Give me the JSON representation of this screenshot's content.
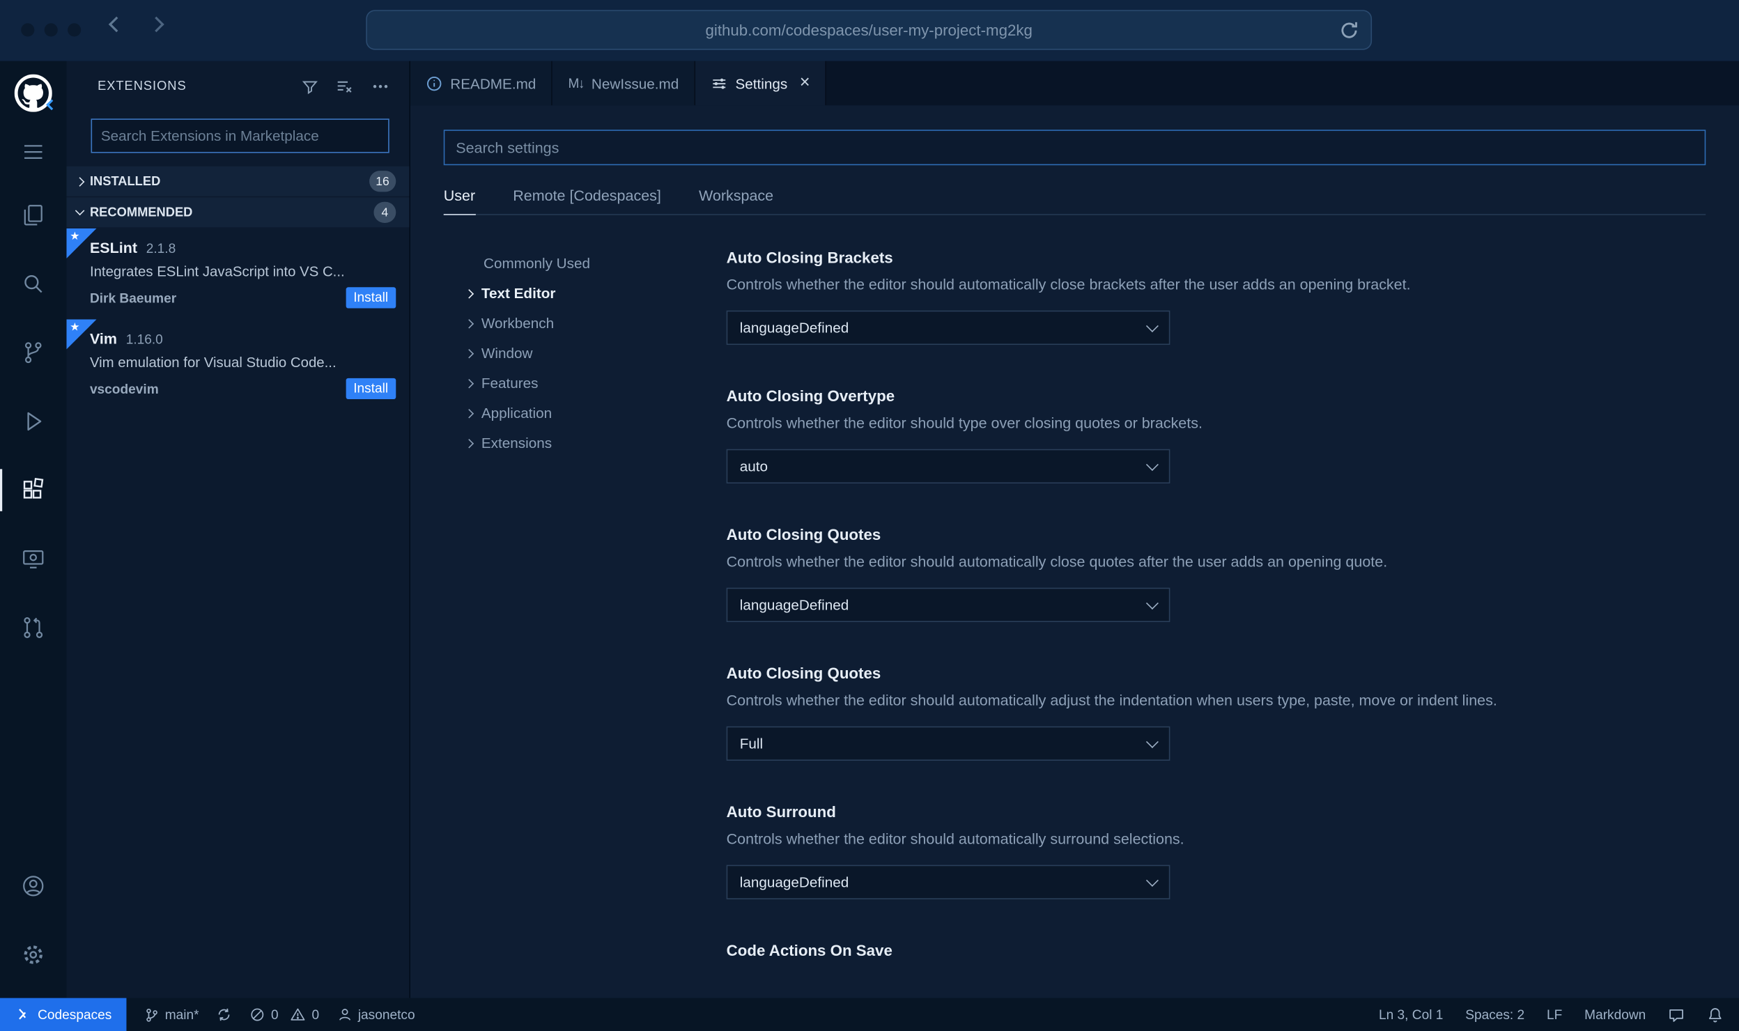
{
  "browser": {
    "url": "github.com/codespaces/user-my-project-mg2kg",
    "icons": [
      "back-arrow",
      "forward-arrow",
      "reload"
    ]
  },
  "activity_bar": {
    "icons": [
      "github-logo",
      "menu",
      "explorer",
      "search",
      "source-control",
      "run-and-debug",
      "extensions",
      "remote-explorer",
      "pull-requests",
      "account",
      "settings-gear"
    ],
    "active": "extensions"
  },
  "sidebar": {
    "title": "EXTENSIONS",
    "action_icons": [
      "filter",
      "clear-extension-search",
      "more-actions"
    ],
    "search": {
      "placeholder": "Search Extensions in Marketplace"
    },
    "sections": [
      {
        "label": "INSTALLED",
        "count": "16"
      },
      {
        "label": "RECOMMENDED",
        "count": "4"
      }
    ],
    "extensions": [
      {
        "name": "ESLint",
        "version": "2.1.8",
        "description": "Integrates ESLint JavaScript into VS C...",
        "publisher": "Dirk Baeumer",
        "action": "Install"
      },
      {
        "name": "Vim",
        "version": "1.16.0",
        "description": "Vim emulation for Visual Studio Code...",
        "publisher": "vscodevim",
        "action": "Install"
      }
    ]
  },
  "editor": {
    "tabs": [
      {
        "label": "README.md",
        "icon": "info"
      },
      {
        "label": "NewIssue.md",
        "icon": "markdown",
        "icon_glyph": "M↓"
      },
      {
        "label": "Settings",
        "icon": "settings-editor",
        "active": true,
        "close_glyph": "×"
      }
    ],
    "settings": {
      "search_placeholder": "Search settings",
      "scopes": [
        {
          "label": "User",
          "active": true
        },
        {
          "label": "Remote [Codespaces]",
          "active": false
        },
        {
          "label": "Workspace",
          "active": false
        }
      ],
      "toc": [
        "Commonly Used",
        "Text Editor",
        "Workbench",
        "Window",
        "Features",
        "Application",
        "Extensions"
      ],
      "active_toc": "Text Editor",
      "items": [
        {
          "title": "Auto Closing Brackets",
          "description": "Controls whether the editor should automatically close brackets after the user adds an opening bracket.",
          "value": "languageDefined"
        },
        {
          "title": "Auto Closing Overtype",
          "description": "Controls whether the editor should type over closing quotes or brackets.",
          "value": "auto"
        },
        {
          "title": "Auto Closing Quotes",
          "description": "Controls whether the editor should automatically close quotes after the user adds an opening quote.",
          "value": "languageDefined"
        },
        {
          "title": "Auto Closing Quotes",
          "description": "Controls whether the editor should automatically adjust the indentation when users type, paste, move or indent lines.",
          "value": "Full"
        },
        {
          "title": "Auto Surround",
          "description": "Controls whether the editor should automatically surround selections.",
          "value": "languageDefined"
        },
        {
          "title": "Code Actions On Save"
        }
      ]
    }
  },
  "status_bar": {
    "codespaces": "Codespaces",
    "branch": "main*",
    "errors": "0",
    "warnings": "0",
    "user": "jasonetco",
    "cursor": "Ln 3, Col 1",
    "indent": "Spaces: 2",
    "eol": "LF",
    "language": "Markdown",
    "icons": [
      "codespaces",
      "git-branch",
      "sync",
      "error",
      "warning",
      "person",
      "feedback",
      "bell"
    ]
  },
  "colors": {
    "accent": "#2f81f7",
    "codespaces_badge": "#1f6feb"
  }
}
